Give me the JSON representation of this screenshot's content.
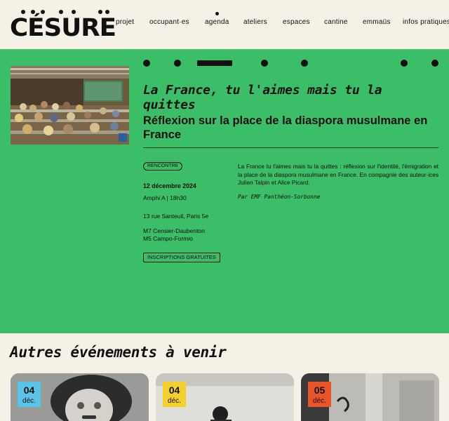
{
  "brand": {
    "logo_text": "CÉSURE"
  },
  "nav": {
    "items": [
      "projet",
      "occupant·es",
      "agenda",
      "ateliers",
      "espaces",
      "cantine",
      "emmaüs",
      "infos pratiques"
    ]
  },
  "event": {
    "title": "La France, tu l'aimes mais tu la quittes",
    "subtitle": "Réflexion sur la place de la diaspora musulmane en France",
    "tag": "RENCONTRE",
    "date": "12 décembre 2024",
    "room_time": "Amphi A | 18h30",
    "address": "13 rue Santeuil, Paris 5e",
    "metro_1": "M7 Censier-Daubenton",
    "metro_2": "M5 Campo-Formio",
    "cta": "INSCRIPTIONS GRATUITES",
    "description": "La France tu l'aimes mais tu la quittes : réflexion sur l'identité, l'émigration et la place de la diaspora musulmane en France. En compagnie des auteur·ices Julien Talpin et Alice Picard.",
    "organizer": "Par EMF Panthéon-Sorbonne"
  },
  "upcoming": {
    "title": "Autres événements à venir",
    "cards": [
      {
        "day": "04",
        "month": "déc.",
        "badge_color": "#5bc3e6"
      },
      {
        "day": "04",
        "month": "déc.",
        "badge_color": "#f3d12a"
      },
      {
        "day": "05",
        "month": "déc.",
        "badge_color": "#e9552a"
      }
    ]
  },
  "colors": {
    "hero_bg": "#3cbd67",
    "page_bg": "#f5f1e6"
  }
}
